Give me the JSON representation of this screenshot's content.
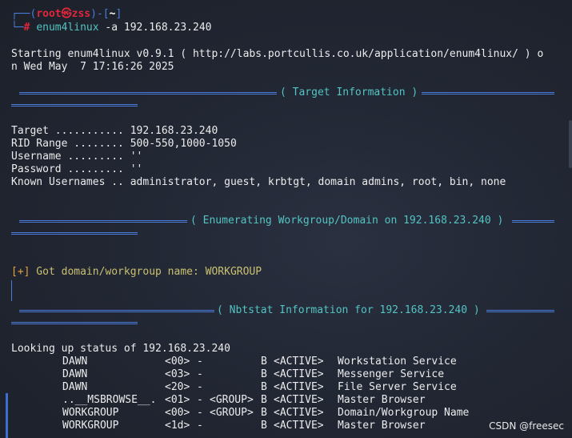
{
  "prompt": {
    "corner_top": "┌──(",
    "user": "root",
    "at_symbol": "㉿",
    "host": "zss",
    "mid": ")-[",
    "cwd": "~",
    "end": "]",
    "corner_bottom": "└─",
    "hash": "#",
    "command_name": "enum4linux",
    "command_args": " -a 192.168.23.240"
  },
  "startup": {
    "line1": "Starting enum4linux v0.9.1 ( http://labs.portcullis.co.uk/application/enum4linux/ ) o",
    "line2": "n Wed May  7 17:16:26 2025"
  },
  "sections": {
    "target_info": "( Target Information )",
    "workgroup": "( Enumerating Workgroup/Domain on 192.168.23.240 )",
    "nbtstat": "( Nbtstat Information for 192.168.23.240 )"
  },
  "target_info": [
    {
      "label": "Target ...........",
      "value": "192.168.23.240"
    },
    {
      "label": "RID Range ........",
      "value": "500-550,1000-1050"
    },
    {
      "label": "Username .........",
      "value": "''"
    },
    {
      "label": "Password .........",
      "value": "''"
    },
    {
      "label": "Known Usernames ..",
      "value": "administrator, guest, krbtgt, domain admins, root, bin, none"
    }
  ],
  "workgroup_result": {
    "tag": "[+]",
    "text": " Got domain/workgroup name: WORKGROUP"
  },
  "nbtstat": {
    "lookup": "Looking up status of 192.168.23.240",
    "rows": [
      {
        "name": "DAWN",
        "code": "<00>",
        "dash": "-",
        "group": "",
        "type": "B",
        "status": "<ACTIVE>",
        "desc": "Workstation Service"
      },
      {
        "name": "DAWN",
        "code": "<03>",
        "dash": "-",
        "group": "",
        "type": "B",
        "status": "<ACTIVE>",
        "desc": "Messenger Service"
      },
      {
        "name": "DAWN",
        "code": "<20>",
        "dash": "-",
        "group": "",
        "type": "B",
        "status": "<ACTIVE>",
        "desc": "File Server Service"
      },
      {
        "name": "..__MSBROWSE__.",
        "code": "<01>",
        "dash": "-",
        "group": "<GROUP>",
        "type": "B",
        "status": "<ACTIVE>",
        "desc": "Master Browser"
      },
      {
        "name": "WORKGROUP",
        "code": "<00>",
        "dash": "-",
        "group": "<GROUP>",
        "type": "B",
        "status": "<ACTIVE>",
        "desc": "Domain/Workgroup Name"
      },
      {
        "name": "WORKGROUP",
        "code": "<1d>",
        "dash": "-",
        "group": "",
        "type": "B",
        "status": "<ACTIVE>",
        "desc": "Master Browser"
      }
    ]
  },
  "watermark": "CSDN @freesec",
  "colors": {
    "background": "#222734",
    "prompt_frame": "#4b7bd8",
    "prompt_user": "#e0263b",
    "section_rule": "#4b7bd8",
    "section_title": "#52c4c4",
    "result_tag": "#e6a23c",
    "result_text": "#c9c070"
  }
}
